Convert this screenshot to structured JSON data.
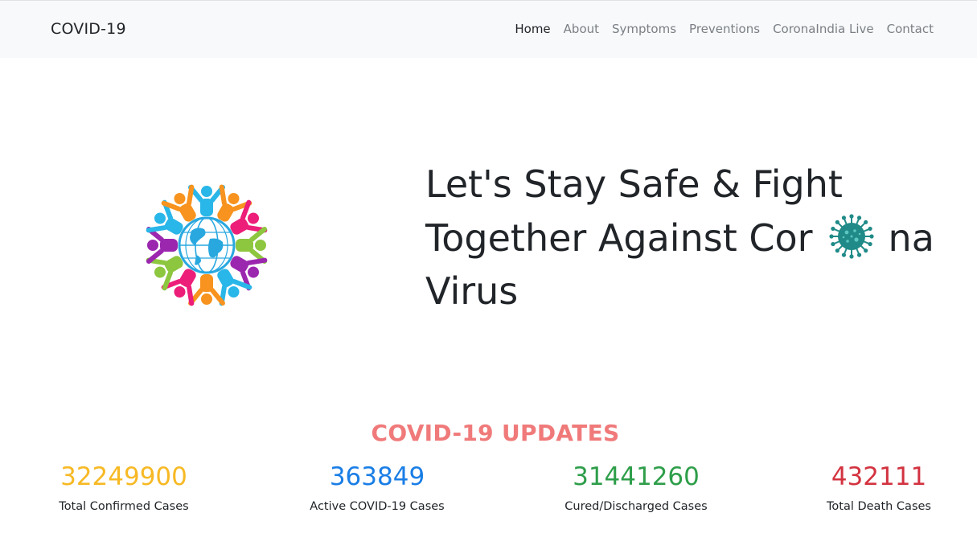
{
  "nav": {
    "brand": "COVID-19",
    "links": [
      {
        "label": "Home",
        "active": true
      },
      {
        "label": "About"
      },
      {
        "label": "Symptoms"
      },
      {
        "label": "Preventions"
      },
      {
        "label": "CoronaIndia Live"
      },
      {
        "label": "Contact"
      }
    ]
  },
  "hero": {
    "headline_part1": "Let's Stay Safe & Fight Together Against Cor",
    "headline_part2": "na Virus",
    "logo_icon": "people-around-globe-icon",
    "inline_icon": "coronavirus-icon"
  },
  "updates": {
    "title": "COVID-19 UPDATES",
    "stats": [
      {
        "value": "32249900",
        "label": "Total Confirmed Cases",
        "color": "#f7b924"
      },
      {
        "value": "363849",
        "label": "Active COVID-19 Cases",
        "color": "#1a7ee6"
      },
      {
        "value": "31441260",
        "label": "Cured/Discharged Cases",
        "color": "#2e9e4a"
      },
      {
        "value": "432111",
        "label": "Total Death Cases",
        "color": "#d33340"
      }
    ]
  },
  "colors": {
    "navbar_bg": "#f8f9fa",
    "updates_title": "#f07a7a",
    "globe": "#29a8e0"
  }
}
